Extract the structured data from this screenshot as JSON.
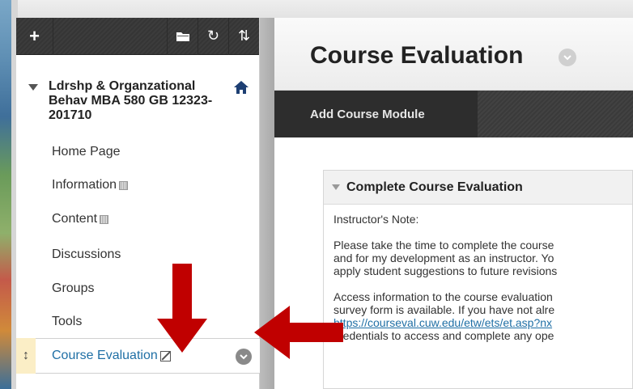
{
  "sidebar": {
    "toolbar": {
      "add_glyph": "+",
      "folder_icon": "folder-icon",
      "refresh_glyph": "↻",
      "sort_glyph": "⇅"
    },
    "course_title": "Ldrshp & Organzational Behav MBA 580 GB 12323-201710",
    "items": [
      {
        "label": "Home Page",
        "hidden": false
      },
      {
        "label": "Information",
        "hidden": true
      },
      {
        "label": "Content",
        "hidden": true
      },
      {
        "label": "Discussions",
        "hidden": false
      },
      {
        "label": "Groups",
        "hidden": false
      },
      {
        "label": "Tools",
        "hidden": false
      }
    ],
    "selected_item": {
      "label": "Course Evaluation",
      "drag_glyph": "↕"
    }
  },
  "main": {
    "page_title": "Course Evaluation",
    "action_button": "Add Course Module",
    "module": {
      "title": "Complete Course Evaluation",
      "paragraphs": [
        "Instructor's Note:",
        "Please take the time to complete the course",
        "and for my development as an instructor. Yo",
        "apply student suggestions to future revisions",
        "Access information to the course evaluation",
        "survey form is available. If you have not alre",
        "https://courseval.cuw.edu/etw/ets/et.asp?nx",
        "credentials to access and complete any ope"
      ]
    }
  },
  "colors": {
    "link": "#1f6fa5",
    "arrow": "#c00000",
    "drag_highlight": "#fbeec6"
  }
}
